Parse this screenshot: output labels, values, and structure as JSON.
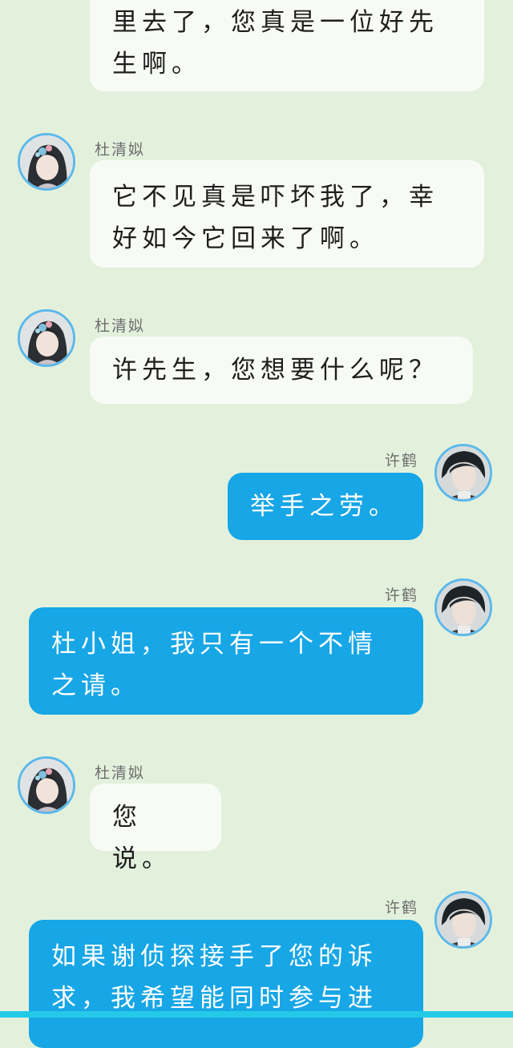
{
  "conversation": {
    "messages": [
      {
        "sender": "",
        "text": "里去了，您真是一位好先生啊。"
      },
      {
        "sender": "杜清姒",
        "text": "它不见真是吓坏我了，幸好如今它回来了啊。"
      },
      {
        "sender": "杜清姒",
        "text": "许先生，您想要什么呢？"
      },
      {
        "sender": "许鹤",
        "text": "举手之劳。"
      },
      {
        "sender": "许鹤",
        "text": "杜小姐，我只有一个不情之请。"
      },
      {
        "sender": "杜清姒",
        "text": "您说。"
      },
      {
        "sender": "许鹤",
        "text": "如果谢侦探接手了您的诉求，我希望能同时参与进"
      }
    ]
  },
  "colors": {
    "background": "#e3f1dc",
    "bubble_other": "#f8fbf5",
    "bubble_me": "#17a6e6",
    "avatar_ring": "#5db8ea",
    "bottom_bar": "#24c9e8"
  },
  "icons": {
    "female_avatar": "avatar-du-qingsi",
    "male_avatar": "avatar-xu-he"
  }
}
